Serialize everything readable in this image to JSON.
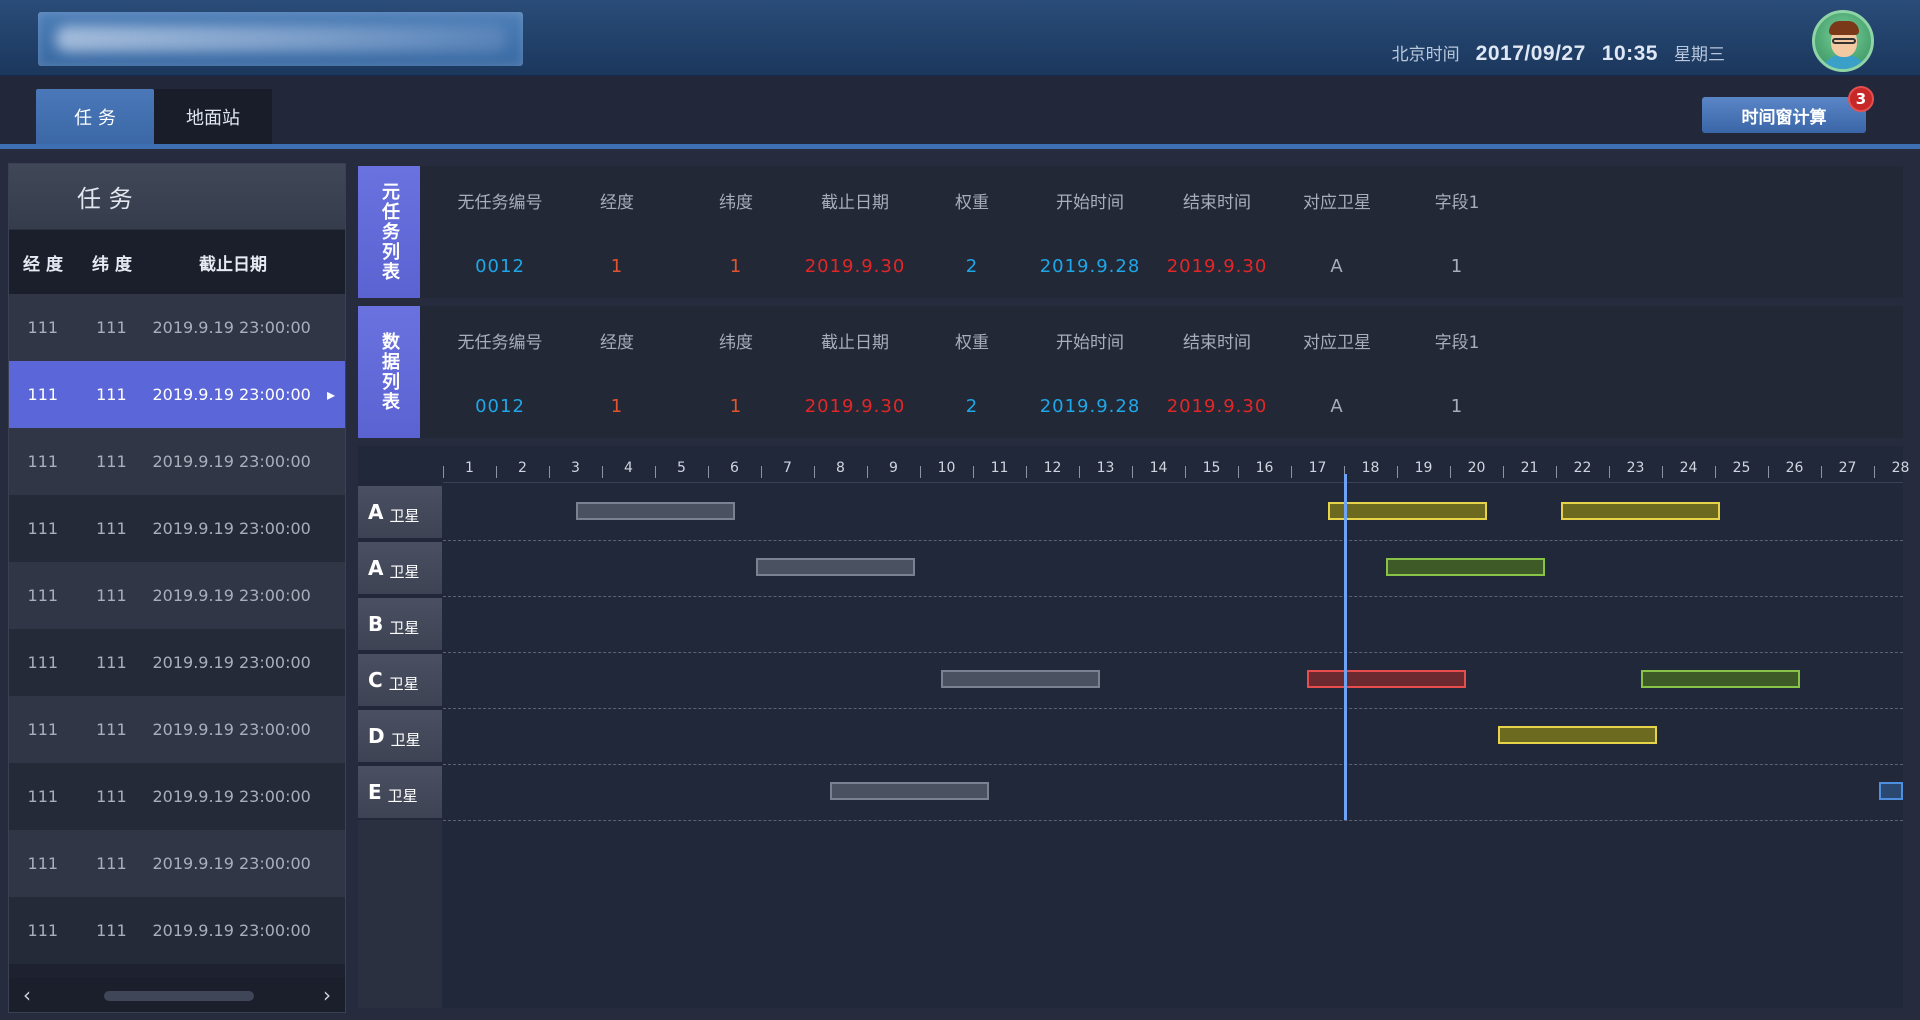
{
  "header": {
    "time_label": "北京时间",
    "date": "2017/09/27",
    "time": "10:35",
    "weekday": "星期三",
    "notification_count": "3"
  },
  "tabs": [
    {
      "label": "任 务",
      "active": true
    },
    {
      "label": "地面站",
      "active": false
    }
  ],
  "calc_button": "时间窗计算",
  "task_panel": {
    "title": "任 务",
    "columns": [
      "经 度",
      "纬 度",
      "截止日期"
    ],
    "rows": [
      {
        "lon": "111",
        "lat": "111",
        "deadline": "2019.9.19  23:00:00",
        "selected": false
      },
      {
        "lon": "111",
        "lat": "111",
        "deadline": "2019.9.19  23:00:00",
        "selected": true
      },
      {
        "lon": "111",
        "lat": "111",
        "deadline": "2019.9.19  23:00:00",
        "selected": false
      },
      {
        "lon": "111",
        "lat": "111",
        "deadline": "2019.9.19  23:00:00",
        "selected": false
      },
      {
        "lon": "111",
        "lat": "111",
        "deadline": "2019.9.19  23:00:00",
        "selected": false
      },
      {
        "lon": "111",
        "lat": "111",
        "deadline": "2019.9.19  23:00:00",
        "selected": false
      },
      {
        "lon": "111",
        "lat": "111",
        "deadline": "2019.9.19  23:00:00",
        "selected": false
      },
      {
        "lon": "111",
        "lat": "111",
        "deadline": "2019.9.19  23:00:00",
        "selected": false
      },
      {
        "lon": "111",
        "lat": "111",
        "deadline": "2019.9.19  23:00:00",
        "selected": false
      },
      {
        "lon": "111",
        "lat": "111",
        "deadline": "2019.9.19  23:00:00",
        "selected": false
      }
    ]
  },
  "meta_task_list": {
    "side_label": "元任务列表",
    "headers": [
      "无任务编号",
      "经度",
      "纬度",
      "截止日期",
      "权重",
      "开始时间",
      "结束时间",
      "对应卫星",
      "字段1"
    ],
    "values": [
      "0012",
      "1",
      "1",
      "2019.9.30",
      "2",
      "2019.9.28",
      "2019.9.30",
      "A",
      "1"
    ],
    "value_colors": [
      "blue",
      "orange",
      "orange",
      "red",
      "blue",
      "blue",
      "red",
      "gray",
      "gray"
    ]
  },
  "data_list": {
    "side_label": "数据列表",
    "headers": [
      "无任务编号",
      "经度",
      "纬度",
      "截止日期",
      "权重",
      "开始时间",
      "结束时间",
      "对应卫星",
      "字段1"
    ],
    "values": [
      "0012",
      "1",
      "1",
      "2019.9.30",
      "2",
      "2019.9.28",
      "2019.9.30",
      "A",
      "1"
    ],
    "value_colors": [
      "blue",
      "orange",
      "orange",
      "red",
      "blue",
      "blue",
      "red",
      "gray",
      "gray"
    ]
  },
  "gantt": {
    "day_labels": [
      "1",
      "2",
      "3",
      "4",
      "5",
      "6",
      "7",
      "8",
      "9",
      "10",
      "11",
      "12",
      "13",
      "14",
      "15",
      "16",
      "17",
      "18",
      "19",
      "20",
      "21",
      "22",
      "23",
      "24",
      "25",
      "26",
      "27",
      "28"
    ],
    "satellite_suffix": "卫星",
    "current_day": 17.5,
    "rows": [
      {
        "letter": "A",
        "bars": [
          {
            "start": 3.0,
            "end": 6.0,
            "color": "gray"
          },
          {
            "start": 17.2,
            "end": 20.2,
            "color": "yellow"
          },
          {
            "start": 21.6,
            "end": 24.6,
            "color": "yellow"
          }
        ]
      },
      {
        "letter": "A",
        "bars": [
          {
            "start": 6.4,
            "end": 9.4,
            "color": "gray"
          },
          {
            "start": 18.3,
            "end": 21.3,
            "color": "green"
          }
        ]
      },
      {
        "letter": "B",
        "bars": []
      },
      {
        "letter": "C",
        "bars": [
          {
            "start": 9.9,
            "end": 12.9,
            "color": "gray"
          },
          {
            "start": 16.8,
            "end": 19.8,
            "color": "red"
          },
          {
            "start": 23.1,
            "end": 26.1,
            "color": "green"
          }
        ]
      },
      {
        "letter": "D",
        "bars": [
          {
            "start": 20.4,
            "end": 23.4,
            "color": "yellow"
          }
        ]
      },
      {
        "letter": "E",
        "bars": [
          {
            "start": 7.8,
            "end": 10.8,
            "color": "gray"
          },
          {
            "start": 27.6,
            "end": 28.9,
            "color": "blue"
          }
        ]
      }
    ]
  }
}
